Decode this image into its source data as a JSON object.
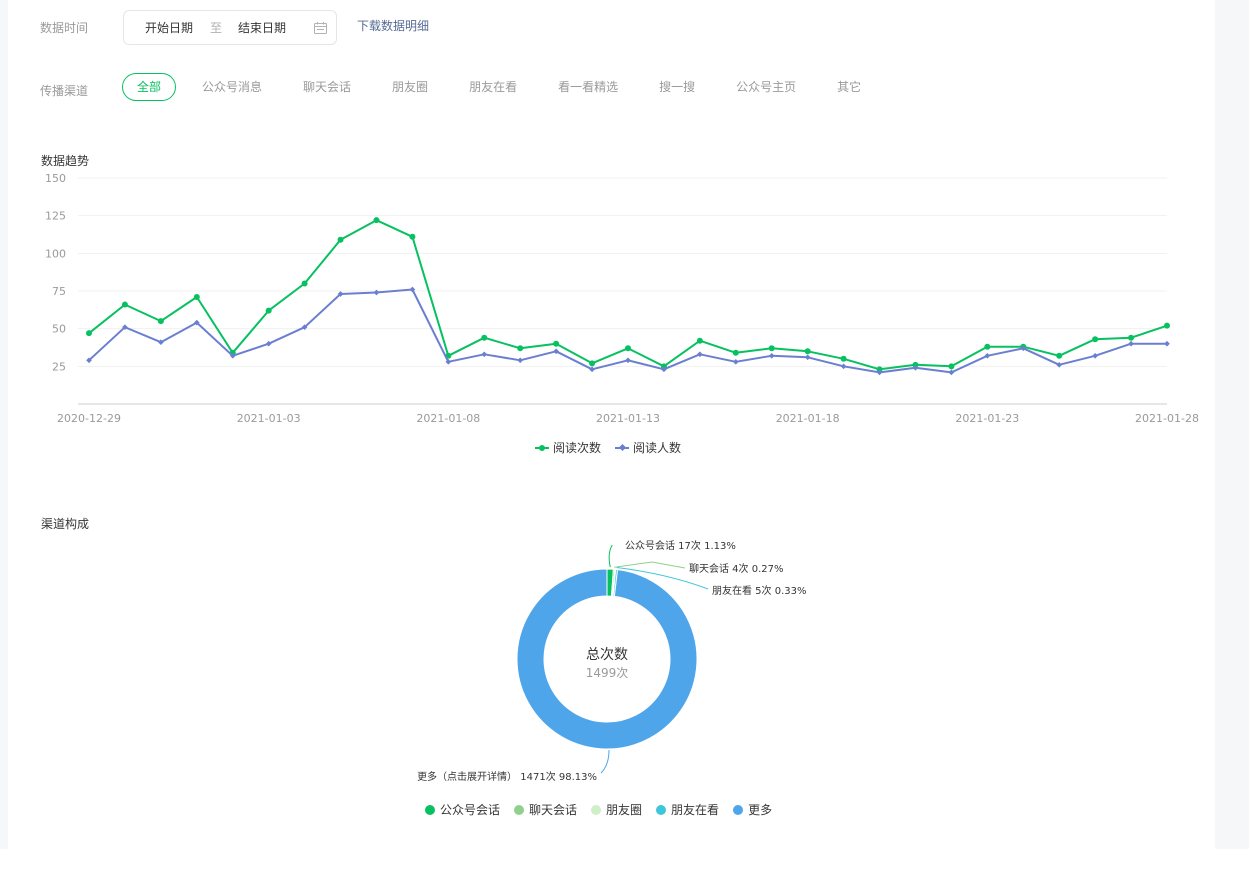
{
  "filters": {
    "date_label": "数据时间",
    "start_date": "开始日期",
    "separator": "至",
    "end_date": "结束日期",
    "download_label": "下载数据明细",
    "channel_label": "传播渠道",
    "channels": [
      "全部",
      "公众号消息",
      "聊天会话",
      "朋友圈",
      "朋友在看",
      "看一看精选",
      "搜一搜",
      "公众号主页",
      "其它"
    ],
    "active_channel": "全部"
  },
  "trend_title": "数据趋势",
  "composition_title": "渠道构成",
  "colors": {
    "green": "#07c160",
    "purple": "#6b7fd1",
    "blue_more": "#4fa5ea",
    "chat_green": "#8fd18a",
    "moments_light": "#d0eec8",
    "zaikan_cyan": "#3ec7d9",
    "accent_link": "#576b95"
  },
  "chart_data": [
    {
      "type": "line",
      "title": "",
      "x": [
        "2020-12-29",
        "2020-12-30",
        "2020-12-31",
        "2021-01-01",
        "2021-01-02",
        "2021-01-03",
        "2021-01-04",
        "2021-01-05",
        "2021-01-06",
        "2021-01-07",
        "2021-01-08",
        "2021-01-09",
        "2021-01-10",
        "2021-01-11",
        "2021-01-12",
        "2021-01-13",
        "2021-01-14",
        "2021-01-15",
        "2021-01-16",
        "2021-01-17",
        "2021-01-18",
        "2021-01-19",
        "2021-01-20",
        "2021-01-21",
        "2021-01-22",
        "2021-01-23",
        "2021-01-24",
        "2021-01-25",
        "2021-01-26",
        "2021-01-27",
        "2021-01-28"
      ],
      "x_ticks": [
        "2020-12-29",
        "2021-01-03",
        "2021-01-08",
        "2021-01-13",
        "2021-01-18",
        "2021-01-23",
        "2021-01-28"
      ],
      "ylim": [
        0,
        150
      ],
      "y_ticks": [
        25,
        50,
        75,
        100,
        125,
        150
      ],
      "grid": true,
      "legend_position": "bottom-center",
      "series": [
        {
          "name": "阅读次数",
          "color": "#07c160",
          "marker": "circle",
          "values": [
            47,
            66,
            55,
            71,
            34,
            62,
            80,
            109,
            122,
            111,
            32,
            44,
            37,
            40,
            27,
            37,
            25,
            42,
            34,
            37,
            35,
            30,
            23,
            26,
            25,
            38,
            38,
            32,
            43,
            44,
            52
          ]
        },
        {
          "name": "阅读人数",
          "color": "#6b7fd1",
          "marker": "diamond",
          "values": [
            29,
            51,
            41,
            54,
            32,
            40,
            51,
            73,
            74,
            76,
            28,
            33,
            29,
            35,
            23,
            29,
            23,
            33,
            28,
            32,
            31,
            25,
            21,
            24,
            21,
            32,
            37,
            26,
            32,
            40,
            40
          ]
        }
      ]
    },
    {
      "type": "pie",
      "donut": true,
      "center_label": "总次数",
      "center_value": "1499次",
      "legend_position": "bottom-center",
      "slices": [
        {
          "name": "公众号会话",
          "value": 17,
          "color": "#07c160",
          "label": "公众号会话 17次 1.13%"
        },
        {
          "name": "聊天会话",
          "value": 4,
          "color": "#8fd18a",
          "label": "聊天会话 4次 0.27%"
        },
        {
          "name": "朋友圈",
          "value": 2,
          "color": "#d0eec8",
          "label": ""
        },
        {
          "name": "朋友在看",
          "value": 5,
          "color": "#3ec7d9",
          "label": "朋友在看 5次 0.33%"
        },
        {
          "name": "更多",
          "value": 1471,
          "color": "#4fa5ea",
          "label": "更多（点击展开详情） 1471次 98.13%"
        }
      ]
    }
  ]
}
